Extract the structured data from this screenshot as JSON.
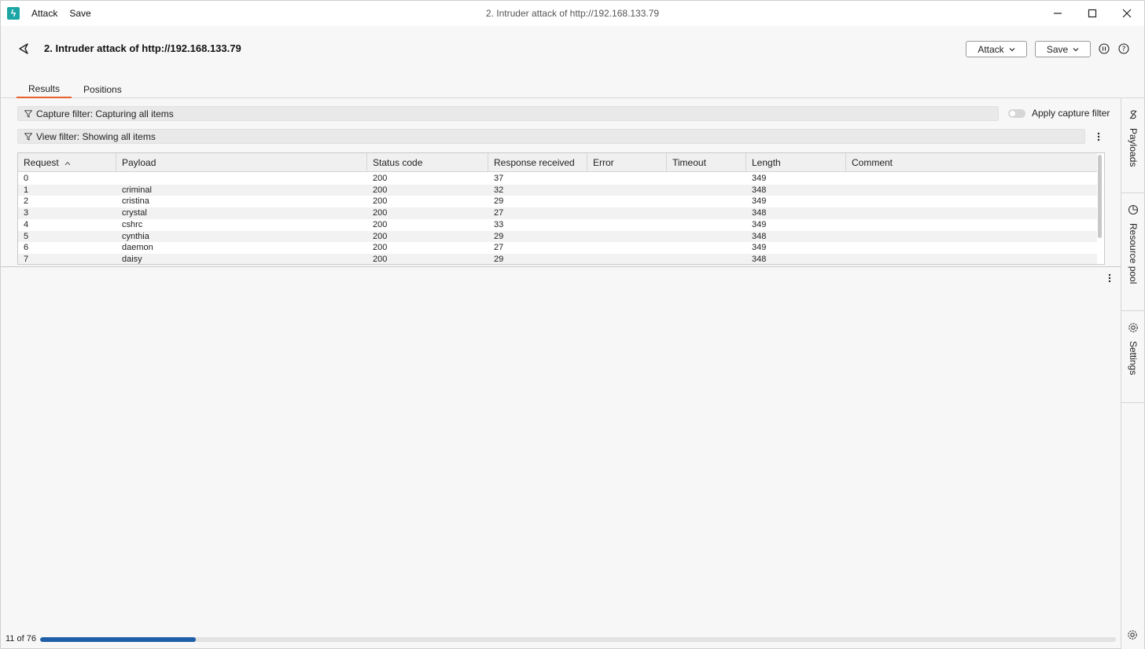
{
  "titlebar": {
    "menu": [
      "Attack",
      "Save"
    ],
    "window_title": "2. Intruder attack of http://192.168.133.79"
  },
  "header": {
    "title": "2. Intruder attack of http://192.168.133.79",
    "attack_button": "Attack",
    "save_button": "Save"
  },
  "tabs": [
    {
      "label": "Results",
      "active": true
    },
    {
      "label": "Positions",
      "active": false
    }
  ],
  "filters": {
    "capture": "Capture filter: Capturing all items",
    "view": "View filter: Showing all items",
    "apply_capture_label": "Apply capture filter"
  },
  "table": {
    "columns": [
      "Request",
      "Payload",
      "Status code",
      "Response received",
      "Error",
      "Timeout",
      "Length",
      "Comment"
    ],
    "rows": [
      [
        "0",
        "",
        "200",
        "37",
        "",
        "",
        "349",
        ""
      ],
      [
        "1",
        "criminal",
        "200",
        "32",
        "",
        "",
        "348",
        ""
      ],
      [
        "2",
        "cristina",
        "200",
        "29",
        "",
        "",
        "349",
        ""
      ],
      [
        "3",
        "crystal",
        "200",
        "27",
        "",
        "",
        "348",
        ""
      ],
      [
        "4",
        "cshrc",
        "200",
        "33",
        "",
        "",
        "349",
        ""
      ],
      [
        "5",
        "cynthia",
        "200",
        "29",
        "",
        "",
        "348",
        ""
      ],
      [
        "6",
        "daemon",
        "200",
        "27",
        "",
        "",
        "349",
        ""
      ],
      [
        "7",
        "daisy",
        "200",
        "29",
        "",
        "",
        "348",
        ""
      ]
    ]
  },
  "side_panel": [
    "Payloads",
    "Resource pool",
    "Settings"
  ],
  "status": {
    "progress_text": "11 of 76",
    "progress_fraction": 0.1447
  },
  "colors": {
    "accent_tab": "#e8602c",
    "progress": "#1f5fa8",
    "logo": "#1ba5a5"
  }
}
